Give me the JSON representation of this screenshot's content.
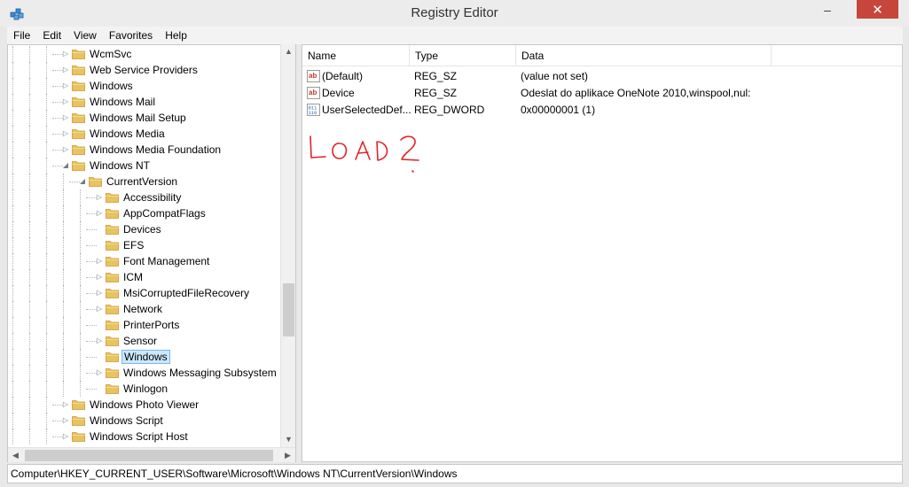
{
  "window": {
    "title": "Registry Editor",
    "minimize_glyph": "–",
    "maximize_glyph": "□",
    "close_glyph": "✕"
  },
  "menu": [
    "File",
    "Edit",
    "View",
    "Favorites",
    "Help"
  ],
  "tree": {
    "rows": [
      {
        "label": "WcmSvc",
        "depth": 3,
        "expandable": true,
        "expanded": false,
        "selected": false
      },
      {
        "label": "Web Service Providers",
        "depth": 3,
        "expandable": true,
        "expanded": false,
        "selected": false
      },
      {
        "label": "Windows",
        "depth": 3,
        "expandable": true,
        "expanded": false,
        "selected": false
      },
      {
        "label": "Windows Mail",
        "depth": 3,
        "expandable": true,
        "expanded": false,
        "selected": false
      },
      {
        "label": "Windows Mail Setup",
        "depth": 3,
        "expandable": true,
        "expanded": false,
        "selected": false
      },
      {
        "label": "Windows Media",
        "depth": 3,
        "expandable": true,
        "expanded": false,
        "selected": false
      },
      {
        "label": "Windows Media Foundation",
        "depth": 3,
        "expandable": true,
        "expanded": false,
        "selected": false
      },
      {
        "label": "Windows NT",
        "depth": 3,
        "expandable": true,
        "expanded": true,
        "selected": false
      },
      {
        "label": "CurrentVersion",
        "depth": 4,
        "expandable": true,
        "expanded": true,
        "selected": false
      },
      {
        "label": "Accessibility",
        "depth": 5,
        "expandable": true,
        "expanded": false,
        "selected": false
      },
      {
        "label": "AppCompatFlags",
        "depth": 5,
        "expandable": true,
        "expanded": false,
        "selected": false
      },
      {
        "label": "Devices",
        "depth": 5,
        "expandable": false,
        "expanded": false,
        "selected": false
      },
      {
        "label": "EFS",
        "depth": 5,
        "expandable": false,
        "expanded": false,
        "selected": false
      },
      {
        "label": "Font Management",
        "depth": 5,
        "expandable": true,
        "expanded": false,
        "selected": false
      },
      {
        "label": "ICM",
        "depth": 5,
        "expandable": true,
        "expanded": false,
        "selected": false
      },
      {
        "label": "MsiCorruptedFileRecovery",
        "depth": 5,
        "expandable": true,
        "expanded": false,
        "selected": false
      },
      {
        "label": "Network",
        "depth": 5,
        "expandable": true,
        "expanded": false,
        "selected": false
      },
      {
        "label": "PrinterPorts",
        "depth": 5,
        "expandable": false,
        "expanded": false,
        "selected": false
      },
      {
        "label": "Sensor",
        "depth": 5,
        "expandable": true,
        "expanded": false,
        "selected": false
      },
      {
        "label": "Windows",
        "depth": 5,
        "expandable": false,
        "expanded": false,
        "selected": true
      },
      {
        "label": "Windows Messaging Subsystem",
        "depth": 5,
        "expandable": true,
        "expanded": false,
        "selected": false
      },
      {
        "label": "Winlogon",
        "depth": 5,
        "expandable": false,
        "expanded": false,
        "selected": false
      },
      {
        "label": "Windows Photo Viewer",
        "depth": 3,
        "expandable": true,
        "expanded": false,
        "selected": false
      },
      {
        "label": "Windows Script",
        "depth": 3,
        "expandable": true,
        "expanded": false,
        "selected": false
      },
      {
        "label": "Windows Script Host",
        "depth": 3,
        "expandable": true,
        "expanded": false,
        "selected": false
      }
    ]
  },
  "list": {
    "columns": [
      "Name",
      "Type",
      "Data"
    ],
    "rows": [
      {
        "icon": "string-value-icon",
        "name": "(Default)",
        "type": "REG_SZ",
        "data": "(value not set)"
      },
      {
        "icon": "string-value-icon",
        "name": "Device",
        "type": "REG_SZ",
        "data": "Odeslat do aplikace OneNote 2010,winspool,nul:"
      },
      {
        "icon": "binary-value-icon",
        "name": "UserSelectedDef...",
        "type": "REG_DWORD",
        "data": "0x00000001 (1)"
      }
    ]
  },
  "annotation": {
    "text": "LOAD ?",
    "color": "#e0242a"
  },
  "statusbar": {
    "path": "Computer\\HKEY_CURRENT_USER\\Software\\Microsoft\\Windows NT\\CurrentVersion\\Windows"
  }
}
